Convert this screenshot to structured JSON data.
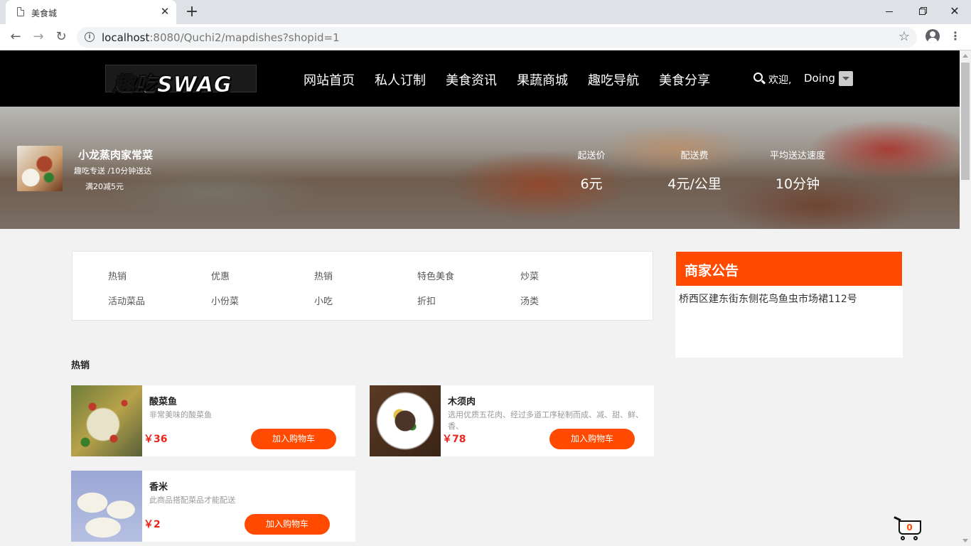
{
  "browser": {
    "tab_title": "美食城",
    "url_host": "localhost",
    "url_rest": ":8080/Quchi2/mapdishes?shopid=1",
    "icons": [
      "page-icon",
      "close-icon",
      "plus-icon",
      "back-icon",
      "forward-icon",
      "reload-icon",
      "info-icon",
      "star-icon",
      "profile-icon",
      "more-menu-icon"
    ]
  },
  "header": {
    "logo": "趣吃SWAG",
    "nav": [
      "网站首页",
      "私人订制",
      "美食资讯",
      "果蔬商城",
      "趣吃导航",
      "美食分享"
    ],
    "welcome": "欢迎,",
    "username": "Doing"
  },
  "shop": {
    "name": "小龙蒸肉家常菜",
    "delivery": "趣吃专送 /10分钟送达",
    "promo": "满20减5元",
    "stats": [
      {
        "label": "起送价",
        "value": "6元"
      },
      {
        "label": "配送费",
        "value": "4元/公里"
      },
      {
        "label": "平均送达速度",
        "value": "10分钟"
      }
    ]
  },
  "categories": [
    [
      "热销",
      "优惠",
      "热销",
      "特色美食",
      "炒菜"
    ],
    [
      "活动菜品",
      "小份菜",
      "小吃",
      "折扣",
      "汤类"
    ]
  ],
  "notice": {
    "title": "商家公告",
    "text": "桥西区建东街东侧花鸟鱼虫市场裙112号"
  },
  "section": {
    "title": "热销"
  },
  "dishes": [
    {
      "name": "酸菜鱼",
      "desc": "非常美味的酸菜鱼",
      "price": "￥36",
      "button": "加入购物车"
    },
    {
      "name": "木须肉",
      "desc": "选用优质五花肉、经过多道工序秘制而成、减、甜、鲜、香、",
      "price": "￥78",
      "button": "加入购物车"
    },
    {
      "name": "香米",
      "desc": "此商品搭配菜品才能配送",
      "price": "￥2",
      "button": "加入购物车"
    }
  ],
  "cart": {
    "count": "0"
  },
  "colors": {
    "accent": "#ff4a00",
    "price": "#e8261c",
    "header_bg": "#000000"
  }
}
